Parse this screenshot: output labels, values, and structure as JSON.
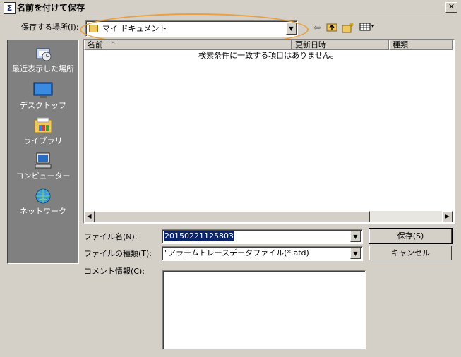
{
  "window": {
    "title": "名前を付けて保存",
    "close": "✕",
    "icon_glyph": "Σ"
  },
  "location": {
    "label": "保存する場所(I):",
    "value": "マイ ドキュメント"
  },
  "toolbar": {
    "icons": [
      "back-icon",
      "up-folder-icon",
      "new-folder-icon",
      "view-menu-icon"
    ]
  },
  "places": [
    {
      "label": "最近表示した場所",
      "icon": "recent-places-icon"
    },
    {
      "label": "デスクトップ",
      "icon": "desktop-icon"
    },
    {
      "label": "ライブラリ",
      "icon": "libraries-icon"
    },
    {
      "label": "コンピューター",
      "icon": "computer-icon"
    },
    {
      "label": "ネットワーク",
      "icon": "network-icon"
    }
  ],
  "file_list": {
    "columns": [
      "名前",
      "更新日時",
      "種類"
    ],
    "empty_message": "検索条件に一致する項目はありません。"
  },
  "form": {
    "filename_label": "ファイル名(N):",
    "filename_value": "20150221125803",
    "filetype_label": "ファイルの種類(T):",
    "filetype_value": "\"アラームトレースデータファイル(*.atd)",
    "comment_label": "コメント情報(C):"
  },
  "buttons": {
    "save": "保存(S)",
    "cancel": "キャンセル"
  },
  "colors": {
    "highlight": "#e8a040",
    "places_bg": "#808080",
    "selection": "#0a246a"
  }
}
